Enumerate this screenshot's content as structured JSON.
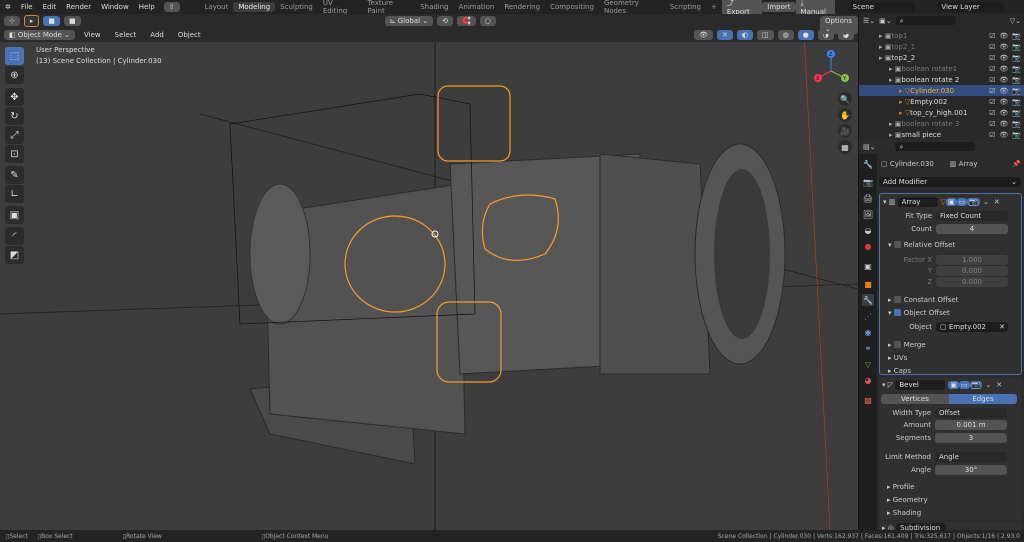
{
  "topbar": {
    "menus": [
      "File",
      "Edit",
      "Render",
      "Window",
      "Help"
    ],
    "workspaces": [
      "Layout",
      "Modeling",
      "Sculpting",
      "UV Editing",
      "Texture Paint",
      "Shading",
      "Animation",
      "Rendering",
      "Compositing",
      "Geometry Nodes",
      "Scripting"
    ],
    "active_workspace": "Modeling",
    "export": "Export",
    "import": "Import",
    "manual": "Manual",
    "scene": "Scene",
    "view_layer": "View Layer"
  },
  "viewport": {
    "mode": "Object Mode",
    "menus": [
      "View",
      "Select",
      "Add",
      "Object"
    ],
    "transform_orientation": "Global",
    "options": "Options",
    "overlay_title": "User Perspective",
    "overlay_sub": "(13) Scene Collection | Cylinder.030",
    "axis": {
      "x": "X",
      "y": "Y",
      "z": "Z"
    },
    "accent": "#ff9a1f"
  },
  "outliner": {
    "items": [
      {
        "label": "top1",
        "dim": true,
        "indent": 1
      },
      {
        "label": "top2_1",
        "dim": true,
        "indent": 1
      },
      {
        "label": "top2_2",
        "dim": false,
        "indent": 1
      },
      {
        "label": "boolean rotate1",
        "dim": true,
        "indent": 2
      },
      {
        "label": "boolean rotate 2",
        "dim": false,
        "indent": 2
      },
      {
        "label": "Cylinder.030",
        "dim": false,
        "indent": 3,
        "selected": true
      },
      {
        "label": "Empty.002",
        "dim": false,
        "indent": 3
      },
      {
        "label": "top_cy_high.001",
        "dim": false,
        "indent": 3
      },
      {
        "label": "boolean rotate 3",
        "dim": true,
        "indent": 2
      },
      {
        "label": "small piece",
        "dim": false,
        "indent": 2
      }
    ]
  },
  "properties": {
    "object": "Cylinder.030",
    "modifier_context": "Array",
    "add_modifier": "Add Modifier",
    "array": {
      "name": "Array",
      "fit_type_label": "Fit Type",
      "fit_type": "Fixed Count",
      "count_label": "Count",
      "count": "4",
      "relative_offset": "Relative Offset",
      "factor_x_label": "Factor X",
      "factor_x": "1.000",
      "y_label": "Y",
      "y": "0.000",
      "z_label": "Z",
      "z": "0.000",
      "constant_offset": "Constant Offset",
      "object_offset": "Object Offset",
      "object_label": "Object",
      "object": "Empty.002",
      "merge": "Merge",
      "uvs": "UVs",
      "caps": "Caps"
    },
    "bevel": {
      "name": "Bevel",
      "vertices": "Vertices",
      "edges": "Edges",
      "width_type_label": "Width Type",
      "width_type": "Offset",
      "amount_label": "Amount",
      "amount": "0.001 m",
      "segments_label": "Segments",
      "segments": "3",
      "limit_method_label": "Limit Method",
      "limit_method": "Angle",
      "angle_label": "Angle",
      "angle": "30°",
      "profile": "Profile",
      "geometry": "Geometry",
      "shading": "Shading"
    },
    "subdivision": {
      "name": "Subdivision"
    }
  },
  "status": {
    "select": "Select",
    "box_select": "Box Select",
    "rotate_view": "Rotate View",
    "context_menu": "Object Context Menu",
    "stats": "Scene Collection | Cylinder.030 | Verts:162,937 | Faces:161,409 | Tris:325,617 | Objects:1/16 | 2.93.0"
  }
}
